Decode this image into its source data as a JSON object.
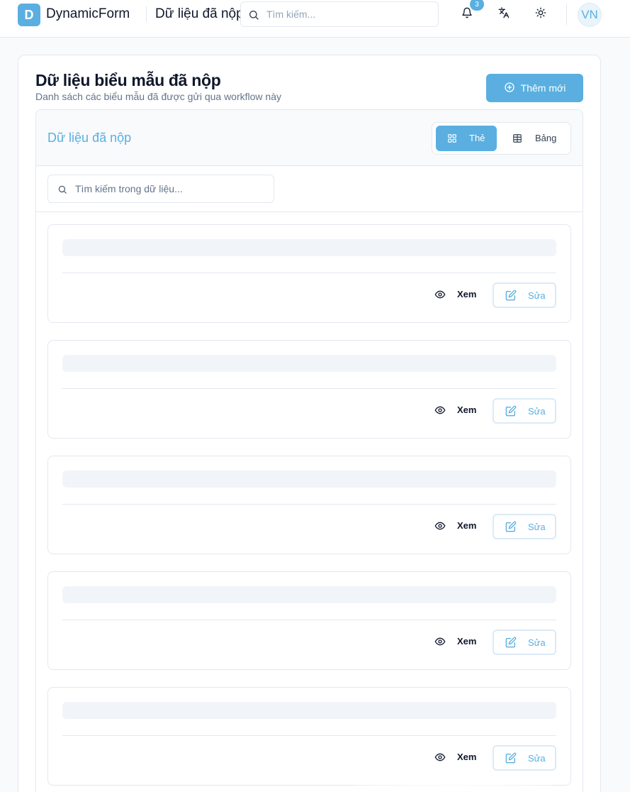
{
  "header": {
    "logo_letter": "D",
    "brand": "DynamicForm",
    "page_heading": "Dữ liệu đã nộp",
    "search_placeholder": "Tìm kiếm...",
    "notification_count": "3",
    "avatar_initials": "VN",
    "icons": [
      "search-icon",
      "bell-icon",
      "translate-icon",
      "sun-icon"
    ]
  },
  "page": {
    "title": "Dữ liệu biểu mẫu đã nộp",
    "subtitle": "Danh sách các biểu mẫu đã được gửi qua workflow này",
    "add_button": "Thêm mới",
    "add_icon": "plus-circle-icon"
  },
  "panel": {
    "title": "Dữ liệu đã nộp",
    "view_toggle": {
      "card_label": "Thẻ",
      "card_icon": "grid-icon",
      "table_label": "Bảng",
      "table_icon": "table-icon",
      "selected": "card"
    },
    "search_placeholder": "Tìm kiếm trong dữ liệu...",
    "cards": [
      {
        "view_label": "Xem",
        "edit_label": "Sửa",
        "loading": true
      },
      {
        "view_label": "Xem",
        "edit_label": "Sửa",
        "loading": true
      },
      {
        "view_label": "Xem",
        "edit_label": "Sửa",
        "loading": true
      },
      {
        "view_label": "Xem",
        "edit_label": "Sửa",
        "loading": true
      },
      {
        "view_label": "Xem",
        "edit_label": "Sửa",
        "loading": true
      }
    ]
  },
  "colors": {
    "accent": "#5aafe0",
    "text": "#0f172a",
    "muted": "#64748b",
    "border": "#e2e8f0",
    "skeleton": "#f1f5f9"
  }
}
